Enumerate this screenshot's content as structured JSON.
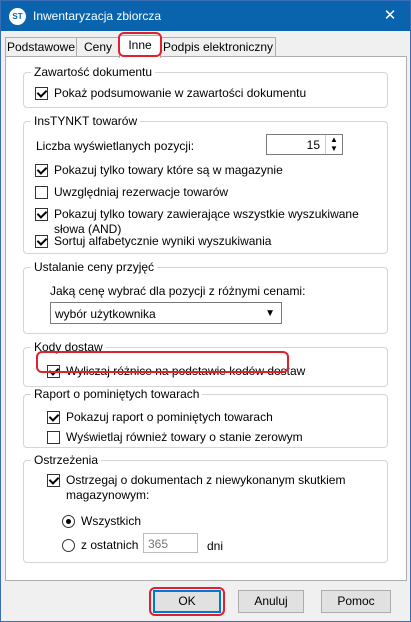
{
  "window": {
    "title": "Inwentaryzacja zbiorcza",
    "app_icon_text": "ST"
  },
  "tabs": [
    "Podstawowe",
    "Ceny",
    "Inne",
    "Podpis elektroniczny"
  ],
  "groups": {
    "zawartosc": {
      "title": "Zawartość dokumentu",
      "show_summary": {
        "label": "Pokaż podsumowanie w zawartości dokumentu",
        "checked": true
      }
    },
    "instynkt": {
      "title": "InsTYNKT towarów",
      "count_label": "Liczba wyświetlanych pozycji:",
      "count_value": "15",
      "only_in_stock": {
        "label": "Pokazuj tylko towary które są w magazynie",
        "checked": true
      },
      "reservations": {
        "label": "Uwzględniaj rezerwacje towarów",
        "checked": false
      },
      "all_words_line1": "Pokazuj tylko towary zawierające wszystkie wyszukiwane",
      "all_words_line2": "słowa (AND)",
      "all_words_checked": true,
      "sort_alpha": {
        "label": "Sortuj alfabetycznie wyniki wyszukiwania",
        "checked": true
      }
    },
    "cena": {
      "title": "Ustalanie ceny przyjęć",
      "question": "Jaką cenę wybrać dla pozycji z różnymi cenami:",
      "selected": "wybór użytkownika"
    },
    "kody": {
      "title": "Kody dostaw",
      "calc": {
        "label": "Wyliczaj różnice na podstawie kodów dostaw",
        "checked": true
      }
    },
    "raport": {
      "title": "Raport o pominiętych towarach",
      "show_report": {
        "label": "Pokazuj raport o pominiętych towarach",
        "checked": true
      },
      "zero_stock": {
        "label": "Wyświetlaj również towary o stanie zerowym",
        "checked": false
      }
    },
    "ostrzezenia": {
      "title": "Ostrzeżenia",
      "warn_line1": "Ostrzegaj o dokumentach z niewykonanym skutkiem",
      "warn_line2": "magazynowym:",
      "warn_checked": true,
      "radio_all": "Wszystkich",
      "radio_last": "z ostatnich",
      "days_value": "365",
      "days_unit": "dni"
    }
  },
  "buttons": {
    "ok": "OK",
    "cancel": "Anuluj",
    "help": "Pomoc"
  },
  "colors": {
    "titlebar": "#0a64ad",
    "highlight": "#e0202a",
    "focus": "#0078d7"
  }
}
